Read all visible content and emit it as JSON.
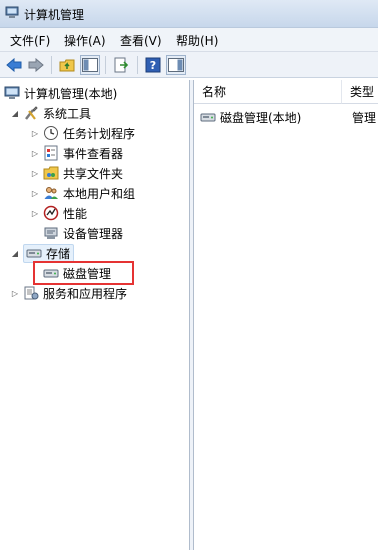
{
  "window": {
    "title": "计算机管理"
  },
  "menu": [
    "文件(F)",
    "操作(A)",
    "查看(V)",
    "帮助(H)"
  ],
  "toolbar": [
    "back-arrow-icon",
    "forward-arrow-icon",
    "up-folder-icon",
    "show-hide-tree-icon",
    "export-list-icon",
    "help-icon",
    "show-hide-action-icon"
  ],
  "tree": {
    "root": "计算机管理(本地)",
    "system_tools": "系统工具",
    "task_scheduler": "任务计划程序",
    "event_viewer": "事件查看器",
    "shared_folders": "共享文件夹",
    "local_users": "本地用户和组",
    "performance": "性能",
    "device_manager": "设备管理器",
    "storage": "存储",
    "disk_management": "磁盘管理",
    "services_apps": "服务和应用程序"
  },
  "list": {
    "col_name": "名称",
    "col_type": "类型",
    "rows": [
      {
        "name": "磁盘管理(本地)",
        "type": "管理"
      }
    ]
  },
  "colors": {
    "highlight": "#e53333",
    "selection": "#e5f0fb"
  }
}
